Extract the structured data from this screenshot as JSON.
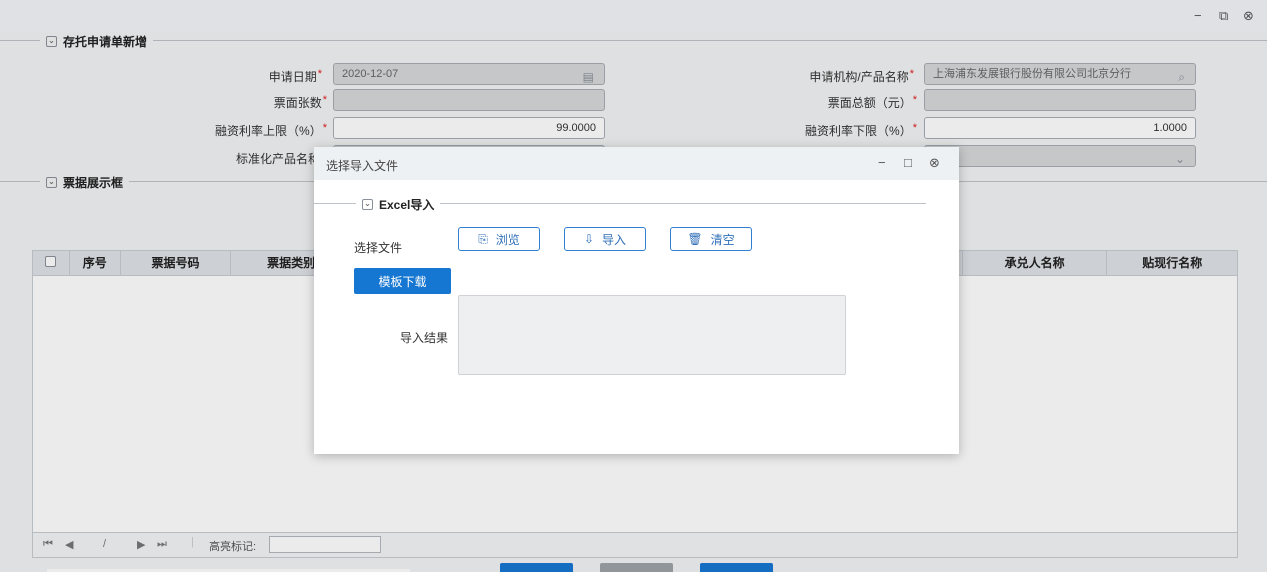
{
  "window": {
    "minimize": "−",
    "restore": "⧉",
    "close": "⊗"
  },
  "form": {
    "section_title": "存托申请单新增",
    "apply_date_label": "申请日期",
    "apply_date_value": "2020-12-07",
    "institution_label": "申请机构/产品名称",
    "institution_value": "上海浦东发展银行股份有限公司北京分行",
    "count_label": "票面张数",
    "count_value": "",
    "amount_label": "票面总额（元）",
    "amount_value": "",
    "rate_upper_label": "融资利率上限（%）",
    "rate_upper_value": "99.0000",
    "rate_lower_label": "融资利率下限（%）",
    "rate_lower_value": "1.0000",
    "product_label": "标准化产品名称",
    "required_mark": "*"
  },
  "grid": {
    "section_title": "票据展示框",
    "columns": [
      "序号",
      "票据号码",
      "票据类别",
      "承兑人名称",
      "贴现行名称"
    ],
    "pager": {
      "first": "⏮",
      "prev": "◀",
      "page_sep": "/",
      "next": "▶",
      "last": "⏭",
      "highlight_label": "高亮标记:",
      "highlight_value": ""
    }
  },
  "dialog": {
    "title": "选择导入文件",
    "section_title": "Excel导入",
    "file_label": "选择文件",
    "browse_label": "浏览",
    "import_label": "导入",
    "clear_label": "清空",
    "template_label": "模板下载",
    "result_label": "导入结果",
    "result_value": "",
    "minimize": "−",
    "maximize": "□",
    "close": "⊗"
  },
  "colors": {
    "accent": "#1677d2",
    "required": "#e02020"
  }
}
